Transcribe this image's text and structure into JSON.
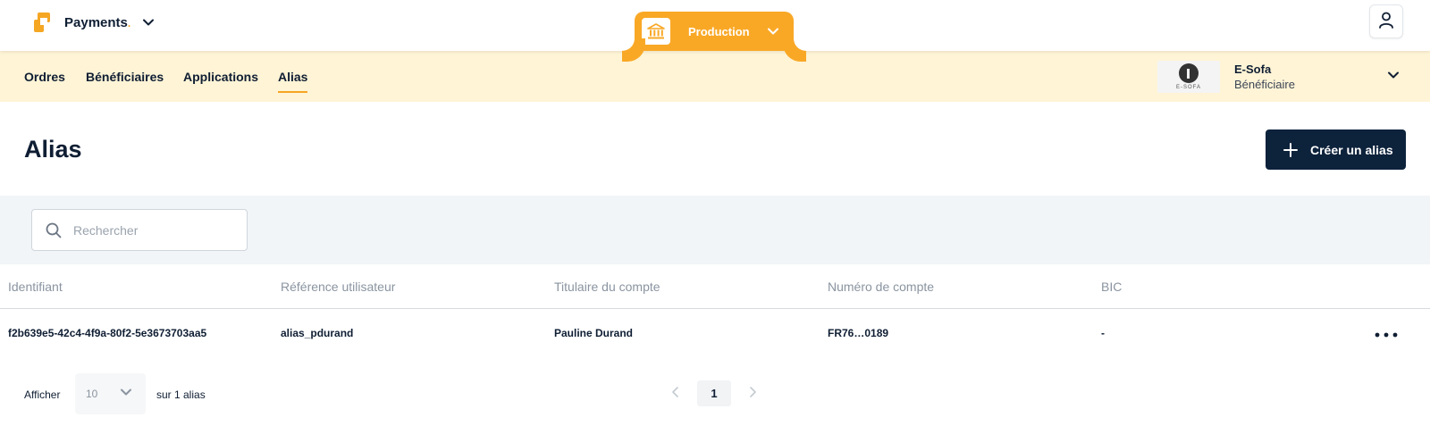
{
  "app": {
    "name": "Payments",
    "name_dot": "."
  },
  "environment": {
    "label": "Production"
  },
  "nav": {
    "items": [
      {
        "label": "Ordres"
      },
      {
        "label": "Bénéficiaires"
      },
      {
        "label": "Applications"
      },
      {
        "label": "Alias",
        "active": true
      }
    ]
  },
  "account": {
    "logo_text": "E-SOFA",
    "name": "E-Sofa",
    "role": "Bénéficiaire"
  },
  "page": {
    "title": "Alias",
    "create_label": "Créer un alias"
  },
  "search": {
    "placeholder": "Rechercher",
    "value": ""
  },
  "table": {
    "columns": [
      "Identifiant",
      "Référence utilisateur",
      "Titulaire du compte",
      "Numéro de compte",
      "BIC"
    ],
    "rows": [
      {
        "id": "f2b639e5-42c4-4f9a-80f2-5e3673703aa5",
        "ref": "alias_pdurand",
        "holder": "Pauline Durand",
        "account": "FR76…0189",
        "bic": "-"
      }
    ]
  },
  "pagination": {
    "show_label": "Afficher",
    "page_size": "10",
    "total_label": "sur 1 alias",
    "current_page": "1"
  },
  "colors": {
    "accent": "#f9a826",
    "nav_bg": "#fff4d6",
    "primary": "#0d223b",
    "filter_bg": "#f1f5f7"
  }
}
